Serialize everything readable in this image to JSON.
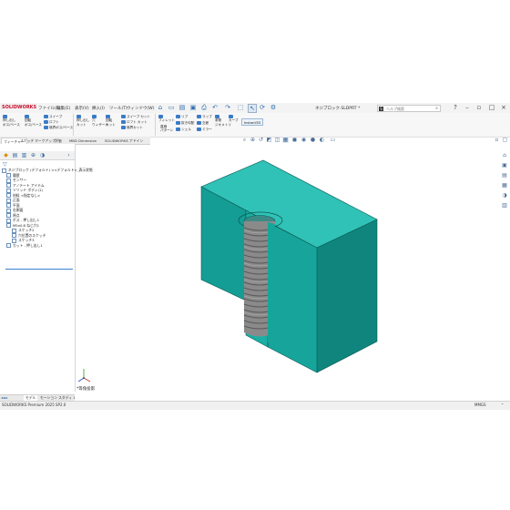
{
  "app": {
    "brand": "SOLIDWORKS",
    "document_title": "ネジブロック.SLDPRT *"
  },
  "menu": [
    "ファイル(F)",
    "編集(E)",
    "表示(V)",
    "挿入(I)",
    "ツール(T)",
    "ウィンドウ(W)"
  ],
  "quick_access_icons": [
    "new-icon",
    "open-icon",
    "save-icon",
    "print-icon",
    "undo-icon",
    "select-icon",
    "rebuild-icon",
    "options-icon"
  ],
  "search": {
    "placeholder": "ヘルプ検索"
  },
  "ribbon": {
    "extrude_boss": [
      "押し出し",
      "ボス/ベース"
    ],
    "revolve_boss": [
      "回転",
      "ボス/ベース"
    ],
    "sweep": "スイープ",
    "loft": "ロフト",
    "boundary_boss": "境界ボス/ベース",
    "extrude_cut": [
      "押し出し",
      "カット"
    ],
    "hole_wizard": [
      "穴",
      "ウィザード"
    ],
    "revolve_cut": [
      "回転",
      "カット"
    ],
    "sweep_cut": "スイープ カット",
    "loft_cut": "ロフト カット",
    "boundary_cut": "境界カット",
    "fillet": "フィレット",
    "linear_pattern": [
      "直線",
      "パターン"
    ],
    "rib": "リブ",
    "draft": "抜き勾配",
    "shell": "シェル",
    "wrap": "ラップ",
    "intersect": "交差",
    "mirror": "ミラー",
    "reference_geometry": [
      "参照",
      "ジオメトリ"
    ],
    "curves": "カーブ",
    "instant3d": "Instant3D"
  },
  "tabs": [
    "フィーチャー",
    "スケッチ",
    "マークアップ",
    "評価",
    "MBD Dimension",
    "SOLIDWORKS アドイン"
  ],
  "feature_tree": [
    "ネジブロック (デフォルト) <<デフォルト>_表示状態",
    "履歴",
    "センサー",
    "アノテート アイテム",
    "ソリッド ボディ(1)",
    "材料 <指定なし>",
    "正面",
    "平面",
    "右側面",
    "原点",
    "ボス - 押し出し1",
    "M5x0.8 ねじ穴1",
    "スケッチ2",
    "穴位置のスケッチ",
    "スケッチ3",
    "カット - 押し出し1"
  ],
  "bottom_tabs": [
    "モデル",
    "モーション スタディ 1"
  ],
  "view_label": "*等角投影",
  "status": {
    "product": "SOLIDWORKS Premium 2025 SP2.0",
    "units": "MMGS"
  },
  "colors": {
    "part": "#1aa39a",
    "part_light": "#2fc4b8",
    "part_dark": "#0d7c74",
    "thread": "#7d7d7d",
    "accent": "#3b7fd0"
  }
}
